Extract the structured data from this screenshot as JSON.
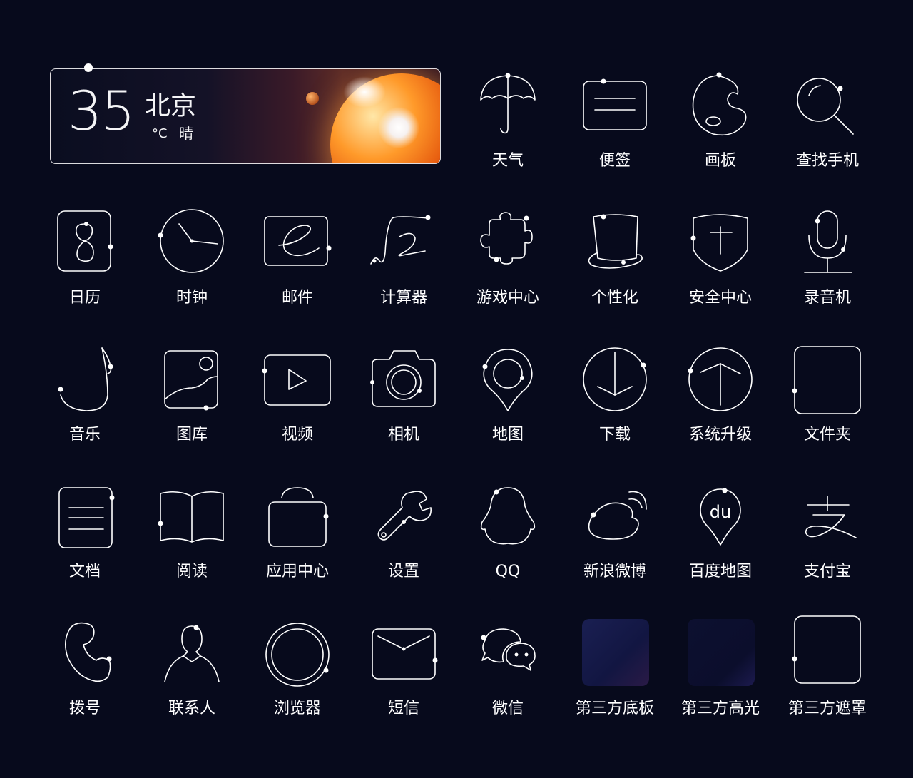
{
  "weather": {
    "temperature": "35",
    "city": "北京",
    "unit": "°C",
    "condition": "晴"
  },
  "apps": [
    {
      "label": "天气",
      "icon": "umbrella-icon"
    },
    {
      "label": "便签",
      "icon": "note-icon"
    },
    {
      "label": "画板",
      "icon": "palette-icon"
    },
    {
      "label": "查找手机",
      "icon": "magnifier-icon"
    },
    {
      "label": "日历",
      "icon": "calendar-icon"
    },
    {
      "label": "时钟",
      "icon": "clock-icon"
    },
    {
      "label": "邮件",
      "icon": "mail-e-icon"
    },
    {
      "label": "计算器",
      "icon": "calculator-sqrt-icon"
    },
    {
      "label": "游戏中心",
      "icon": "puzzle-icon"
    },
    {
      "label": "个性化",
      "icon": "top-hat-icon"
    },
    {
      "label": "安全中心",
      "icon": "shield-icon"
    },
    {
      "label": "录音机",
      "icon": "microphone-icon"
    },
    {
      "label": "音乐",
      "icon": "music-note-icon"
    },
    {
      "label": "图库",
      "icon": "picture-icon"
    },
    {
      "label": "视频",
      "icon": "play-icon"
    },
    {
      "label": "相机",
      "icon": "camera-icon"
    },
    {
      "label": "地图",
      "icon": "map-pin-icon"
    },
    {
      "label": "下载",
      "icon": "download-icon"
    },
    {
      "label": "系统升级",
      "icon": "upgrade-icon"
    },
    {
      "label": "文件夹",
      "icon": "folder-icon"
    },
    {
      "label": "文档",
      "icon": "document-icon"
    },
    {
      "label": "阅读",
      "icon": "book-icon"
    },
    {
      "label": "应用中心",
      "icon": "bag-icon"
    },
    {
      "label": "设置",
      "icon": "wrench-icon"
    },
    {
      "label": "QQ",
      "icon": "penguin-icon"
    },
    {
      "label": "新浪微博",
      "icon": "weibo-icon"
    },
    {
      "label": "百度地图",
      "icon": "baidu-map-icon"
    },
    {
      "label": "支付宝",
      "icon": "alipay-icon"
    },
    {
      "label": "拨号",
      "icon": "phone-icon"
    },
    {
      "label": "联系人",
      "icon": "contact-icon"
    },
    {
      "label": "浏览器",
      "icon": "browser-ring-icon"
    },
    {
      "label": "短信",
      "icon": "envelope-icon"
    },
    {
      "label": "微信",
      "icon": "wechat-icon"
    },
    {
      "label": "第三方底板",
      "icon": "third-party-base-icon"
    },
    {
      "label": "第三方高光",
      "icon": "third-party-highlight-icon"
    },
    {
      "label": "第三方遮罩",
      "icon": "third-party-mask-icon"
    }
  ]
}
